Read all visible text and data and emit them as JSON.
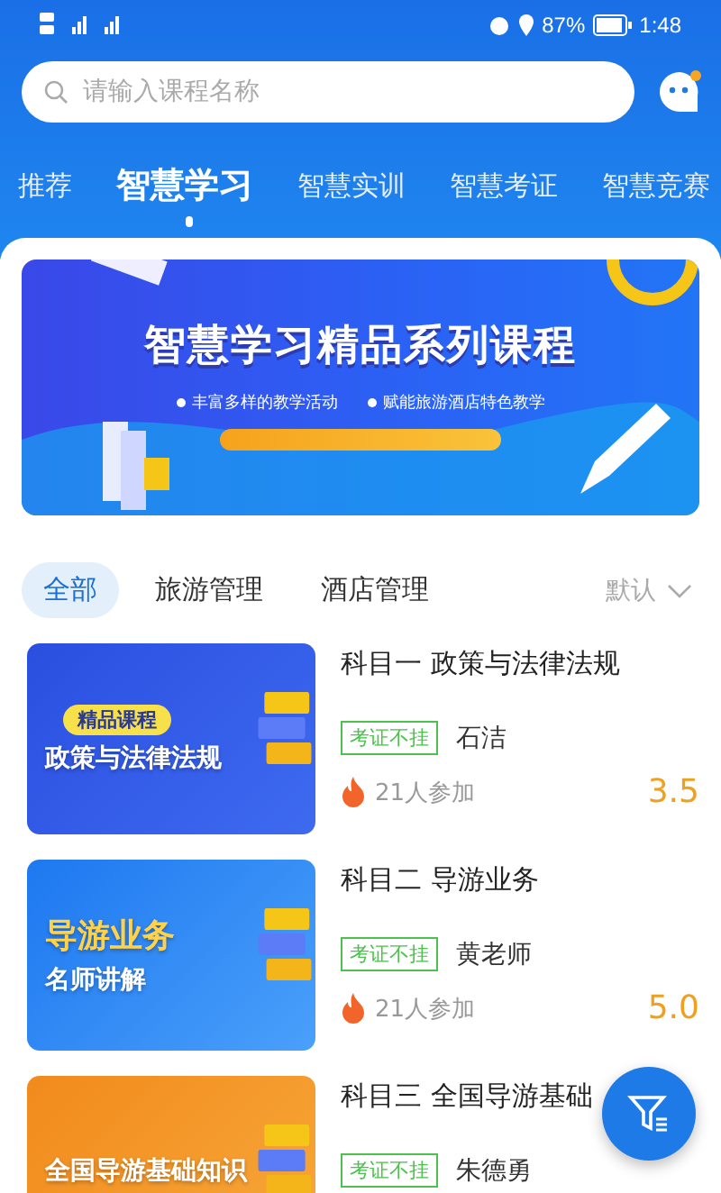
{
  "status_bar": {
    "battery": "87%",
    "time": "1:48"
  },
  "search": {
    "placeholder": "请输入课程名称"
  },
  "tabs": [
    {
      "label": "推荐",
      "selected": false
    },
    {
      "label": "智慧学习",
      "selected": true
    },
    {
      "label": "智慧实训",
      "selected": false
    },
    {
      "label": "智慧考证",
      "selected": false
    },
    {
      "label": "智慧竞赛",
      "selected": false
    }
  ],
  "banner": {
    "title": "智慧学习精品系列课程",
    "bullets": [
      "丰富多样的教学活动",
      "赋能旅游酒店特色教学"
    ]
  },
  "filters": [
    {
      "label": "全部",
      "selected": true
    },
    {
      "label": "旅游管理",
      "selected": false
    },
    {
      "label": "酒店管理",
      "selected": false
    }
  ],
  "sort": {
    "label": "默认"
  },
  "courses": [
    {
      "thumb_badge": "精品课程",
      "thumb_lines": [
        "政策与法律法规"
      ],
      "title": "科目一 政策与法律法规",
      "tag": "考证不挂",
      "teacher": "石洁",
      "participants": "21人参加",
      "rating": "3.5"
    },
    {
      "thumb_lines": [
        "导游业务",
        "名师讲解"
      ],
      "title": "科目二 导游业务",
      "tag": "考证不挂",
      "teacher": "黄老师",
      "participants": "21人参加",
      "rating": "5.0"
    },
    {
      "thumb_lines": [
        "全国导游基础知识"
      ],
      "title": "科目三 全国导游基础",
      "tag": "考证不挂",
      "teacher": "朱德勇"
    }
  ]
}
